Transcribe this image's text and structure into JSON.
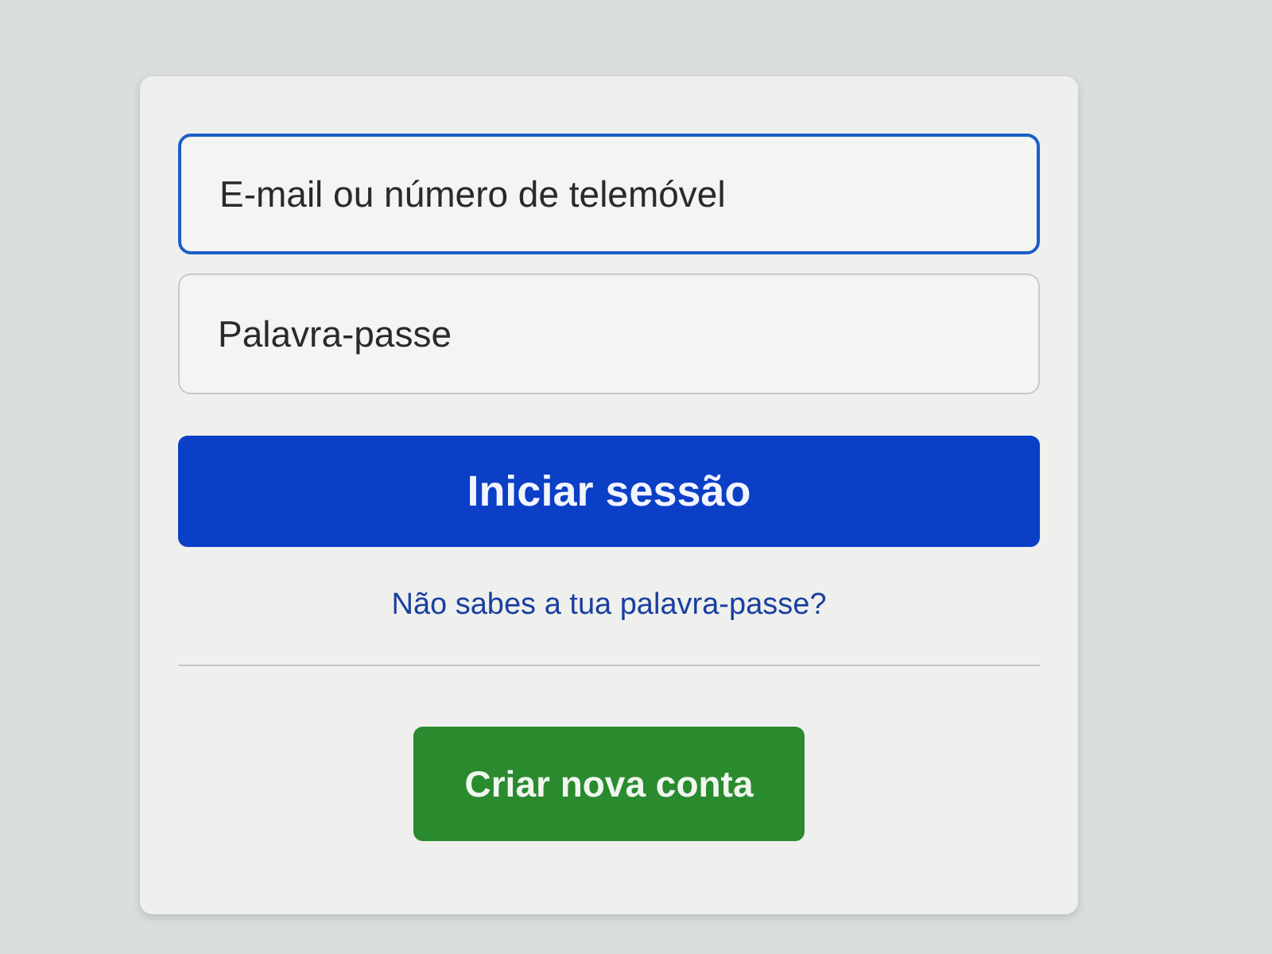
{
  "login_form": {
    "email_field": {
      "placeholder": "E-mail ou número de telemóvel",
      "focused": true
    },
    "password_field": {
      "placeholder": "Palavra-passe",
      "focused": false
    },
    "login_button": "Iniciar sessão",
    "forgot_password_link": "Não sabes a tua palavra-passe?",
    "create_account_button": "Criar nova conta"
  }
}
